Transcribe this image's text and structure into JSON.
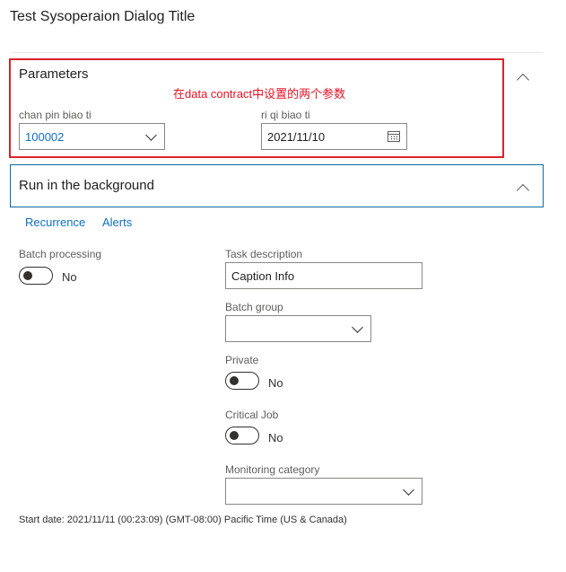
{
  "dialog": {
    "title": "Test Sysoperaion Dialog Title"
  },
  "parameters": {
    "heading": "Parameters",
    "annotation": "在data contract中设置的两个参数",
    "product_field": {
      "label": "chan pin biao ti",
      "value": "100002"
    },
    "date_field": {
      "label": "ri qi biao ti",
      "value": "2021/11/10"
    }
  },
  "background": {
    "heading": "Run in the background",
    "tabs": [
      "Recurrence",
      "Alerts"
    ],
    "batch_processing": {
      "label": "Batch processing",
      "state": "No"
    },
    "task_description": {
      "label": "Task description",
      "value": "Caption Info"
    },
    "batch_group": {
      "label": "Batch group",
      "value": ""
    },
    "private": {
      "label": "Private",
      "state": "No"
    },
    "critical_job": {
      "label": "Critical Job",
      "state": "No"
    },
    "monitoring_category": {
      "label": "Monitoring category",
      "value": ""
    },
    "start_date": "Start date: 2021/11/11 (00:23:09) (GMT-08:00) Pacific Time (US & Canada)"
  },
  "colors": {
    "accent_link": "#106ebe",
    "annotation_red": "#e81123",
    "focus_border": "#0b6a9e"
  }
}
